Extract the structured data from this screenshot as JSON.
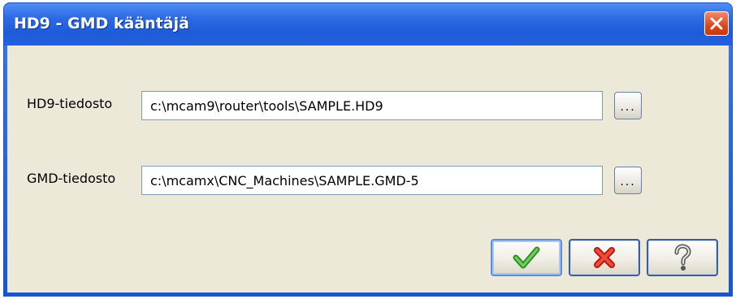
{
  "window": {
    "title": "HD9 - GMD kääntäjä",
    "close_icon": "close-icon"
  },
  "form": {
    "hd9_label": "HD9-tiedosto",
    "hd9_value": "c:\\mcam9\\router\\tools\\SAMPLE.HD9",
    "gmd_label": "GMD-tiedosto",
    "gmd_value": "c:\\mcamx\\CNC_Machines\\SAMPLE.GMD-5",
    "browse_label": "..."
  },
  "buttons": {
    "ok_icon": "checkmark-icon",
    "cancel_icon": "red-x-icon",
    "help_icon": "question-mark-icon"
  },
  "colors": {
    "titlebar": "#1d5bd8",
    "client": "#ece9d8",
    "ok_green": "#3aa82c",
    "cancel_red": "#e0261b"
  }
}
